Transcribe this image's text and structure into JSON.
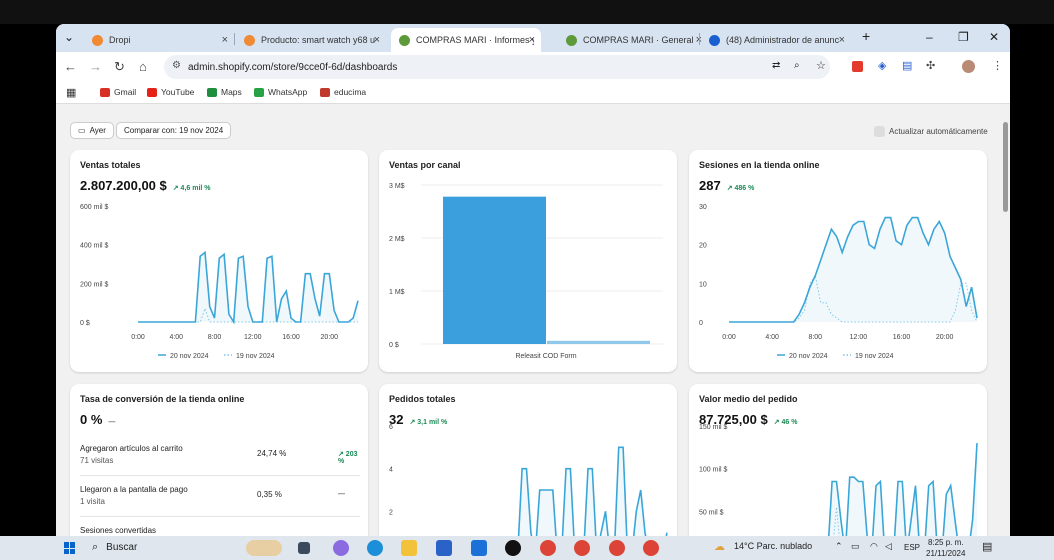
{
  "browser": {
    "tabs": [
      {
        "title": "Dropi",
        "color": "#f08a35",
        "active": false
      },
      {
        "title": "Producto: smart watch y68 u",
        "color": "#f08a35",
        "active": false
      },
      {
        "title": "COMPRAS MARI · Informes y",
        "color": "#5e9a3a",
        "active": true
      },
      {
        "title": "COMPRAS MARI · General ·",
        "color": "#5e9a3a",
        "active": false
      },
      {
        "title": "(48) Administrador de anunc",
        "color": "#1a5fd0",
        "active": false
      }
    ],
    "close_glyph": "×",
    "new_tab_glyph": "+",
    "url": "admin.shopify.com/store/9cce0f-6d/dashboards",
    "bookmarks": [
      {
        "label": "Gmail",
        "color": "#d93025"
      },
      {
        "label": "YouTube",
        "color": "#e62117"
      },
      {
        "label": "Maps",
        "color": "#1e8e3e"
      },
      {
        "label": "WhatsApp",
        "color": "#25a244"
      },
      {
        "label": "educima",
        "color": "#c0392b"
      }
    ]
  },
  "dashboard": {
    "date_button": "Ayer",
    "compare_button": "Comparar con: 19 nov 2024",
    "auto_update": "Actualizar automáticamente",
    "legend_current": "20 nov 2024",
    "legend_previous": "19 nov 2024",
    "accent": "#3aa6d8",
    "cards": {
      "sales": {
        "title": "Ventas totales",
        "value": "2.807.200,00 $",
        "delta": "↗ 4,6 mil %"
      },
      "channel": {
        "title": "Ventas por canal"
      },
      "sessions": {
        "title": "Sesiones en la tienda online",
        "value": "287",
        "delta": "↗ 486 %"
      },
      "conversion": {
        "title": "Tasa de conversión de la tienda online",
        "value": "0 %",
        "delta": "—"
      },
      "orders": {
        "title": "Pedidos totales",
        "value": "32",
        "delta": "↗ 3,1 mil %"
      },
      "aov": {
        "title": "Valor medio del pedido",
        "value": "87.725,00 $",
        "delta": "↗ 46 %"
      }
    },
    "conversion_rows": [
      {
        "label": "Agregaron artículos al carrito",
        "sub": "71 visitas",
        "pct": "24,74 %",
        "delta": "↗ 203 %"
      },
      {
        "label": "Llegaron a la pantalla de pago",
        "sub": "1 visita",
        "pct": "0,35 %",
        "delta": "—"
      },
      {
        "label": "Sesiones convertidas",
        "sub": "",
        "pct": "",
        "delta": ""
      }
    ]
  },
  "chart_data": [
    {
      "type": "line",
      "title": "Ventas totales",
      "x_ticks": [
        "0:00",
        "4:00",
        "8:00",
        "12:00",
        "16:00",
        "20:00"
      ],
      "y_ticks": [
        "0 $",
        "200 mil $",
        "400 mil $",
        "600 mil $"
      ],
      "ylim": [
        0,
        600000
      ],
      "x": [
        0,
        1,
        2,
        3,
        4,
        5,
        6,
        6.5,
        7,
        7.5,
        8,
        8.5,
        9,
        9.5,
        10,
        10.5,
        11,
        11.5,
        12,
        12.5,
        13,
        13.5,
        14,
        14.5,
        15,
        15.5,
        16,
        16.5,
        17,
        17.5,
        18,
        18.5,
        19,
        19.5,
        20,
        20.5,
        21,
        21.5,
        22,
        22.5,
        23
      ],
      "series": [
        {
          "name": "20 nov 2024",
          "values": [
            0,
            0,
            0,
            0,
            0,
            0,
            0,
            340000,
            360000,
            80000,
            20000,
            330000,
            350000,
            40000,
            0,
            330000,
            340000,
            80000,
            0,
            0,
            0,
            330000,
            340000,
            0,
            120000,
            160000,
            20000,
            0,
            0,
            250000,
            250000,
            120000,
            30000,
            250000,
            250000,
            60000,
            0,
            0,
            0,
            20000,
            110000
          ]
        },
        {
          "name": "19 nov 2024",
          "values": [
            0,
            0,
            0,
            0,
            0,
            0,
            0,
            0,
            70000,
            0,
            0,
            0,
            0,
            0,
            0,
            0,
            0,
            0,
            0,
            0,
            0,
            0,
            0,
            0,
            0,
            0,
            0,
            0,
            0,
            0,
            0,
            0,
            0,
            0,
            0,
            0,
            0,
            0,
            0,
            0,
            0
          ]
        }
      ]
    },
    {
      "type": "bar",
      "title": "Ventas por canal",
      "categories": [
        "Releasit COD Form",
        ""
      ],
      "y_ticks": [
        "0 $",
        "1 M$",
        "2 M$",
        "3 M$"
      ],
      "ylim": [
        0,
        3000000
      ],
      "series": [
        {
          "name": "20 nov 2024",
          "values": [
            2780000,
            0
          ]
        },
        {
          "name": "19 nov 2024",
          "values": [
            0,
            60000
          ]
        }
      ]
    },
    {
      "type": "line",
      "title": "Sesiones en la tienda online",
      "x_ticks": [
        "0:00",
        "4:00",
        "8:00",
        "12:00",
        "16:00",
        "20:00"
      ],
      "y_ticks": [
        "0",
        "10",
        "20",
        "30"
      ],
      "ylim": [
        0,
        30
      ],
      "x": [
        0,
        1,
        2,
        3,
        4,
        5,
        6,
        6.5,
        7,
        7.5,
        8,
        8.5,
        9,
        9.5,
        10,
        10.5,
        11,
        11.5,
        12,
        12.5,
        13,
        13.5,
        14,
        14.5,
        15,
        15.5,
        16,
        16.5,
        17,
        17.5,
        18,
        18.5,
        19,
        19.5,
        20,
        20.5,
        21,
        21.5,
        22,
        22.5,
        23
      ],
      "series": [
        {
          "name": "20 nov 2024",
          "values": [
            0,
            0,
            0,
            0,
            0,
            0,
            0,
            2,
            5,
            9,
            12,
            16,
            20,
            24,
            22,
            18,
            22,
            25,
            26,
            26,
            20,
            19,
            24,
            27,
            27,
            21,
            20,
            25,
            27,
            27,
            23,
            20,
            24,
            26,
            23,
            17,
            14,
            11,
            4,
            9,
            1
          ]
        },
        {
          "name": "19 nov 2024",
          "values": [
            0,
            0,
            0,
            0,
            0,
            0,
            0,
            1,
            3,
            10,
            12,
            5,
            5,
            2,
            1,
            0,
            0,
            0,
            0,
            0,
            0,
            0,
            0,
            0,
            0,
            0,
            0,
            0,
            0,
            0,
            0,
            0,
            0,
            0,
            0,
            0,
            3,
            10,
            10,
            3,
            0
          ]
        }
      ]
    },
    {
      "type": "line",
      "title": "Pedidos totales",
      "y_ticks": [
        "2",
        "4",
        "6"
      ],
      "ylim": [
        0,
        6
      ],
      "x": [
        0,
        1,
        2,
        3,
        4,
        5,
        6,
        6.5,
        7,
        7.5,
        8,
        8.5,
        9,
        9.5,
        10,
        10.5,
        11,
        11.5,
        12,
        12.5,
        13,
        13.5,
        14,
        14.5,
        15,
        15.5,
        16,
        16.5,
        17,
        17.5,
        18,
        18.5,
        19,
        19.5,
        20,
        20.5,
        21,
        21.5,
        22,
        22.5,
        23
      ],
      "series": [
        {
          "name": "20 nov 2024",
          "values": [
            0,
            0,
            0,
            0,
            0,
            0,
            0,
            4,
            4,
            1,
            0,
            3,
            3,
            3,
            3,
            0,
            0,
            4,
            4,
            0,
            0,
            0,
            4,
            4,
            0,
            1,
            2,
            0,
            0,
            5,
            5,
            0,
            0,
            2,
            3,
            1,
            0,
            0,
            0,
            0,
            1
          ]
        }
      ]
    },
    {
      "type": "line",
      "title": "Valor medio del pedido",
      "y_ticks": [
        "50 mil $",
        "100 mil $",
        "150 mil $"
      ],
      "ylim": [
        0,
        150000
      ],
      "x": [
        0,
        1,
        2,
        3,
        4,
        5,
        6,
        6.5,
        7,
        7.5,
        8,
        8.5,
        9,
        9.5,
        10,
        10.5,
        11,
        11.5,
        12,
        12.5,
        13,
        13.5,
        14,
        14.5,
        15,
        15.5,
        16,
        16.5,
        17,
        17.5,
        18,
        18.5,
        19,
        19.5,
        20,
        20.5,
        21,
        21.5,
        22,
        22.5,
        23
      ],
      "series": [
        {
          "name": "20 nov 2024",
          "values": [
            0,
            0,
            0,
            0,
            0,
            0,
            0,
            85000,
            85000,
            40000,
            0,
            90000,
            90000,
            85000,
            85000,
            20000,
            0,
            80000,
            85000,
            0,
            0,
            0,
            85000,
            85000,
            0,
            40000,
            80000,
            0,
            0,
            80000,
            85000,
            0,
            0,
            70000,
            80000,
            40000,
            0,
            0,
            0,
            40000,
            130000
          ]
        },
        {
          "name": "19 nov 2024",
          "values": [
            0,
            0,
            0,
            0,
            0,
            0,
            0,
            0,
            55000,
            0,
            0,
            0,
            0,
            0,
            0,
            0,
            0,
            0,
            0,
            0,
            0,
            0,
            0,
            0,
            0,
            0,
            0,
            0,
            0,
            0,
            0,
            0,
            0,
            0,
            0,
            0,
            0,
            0,
            0,
            0,
            0
          ]
        }
      ]
    }
  ],
  "taskbar": {
    "search": "Buscar",
    "weather": "14°C  Parc. nublado",
    "lang": "ESP",
    "time": "8:25 p. m.",
    "date": "21/11/2024"
  }
}
